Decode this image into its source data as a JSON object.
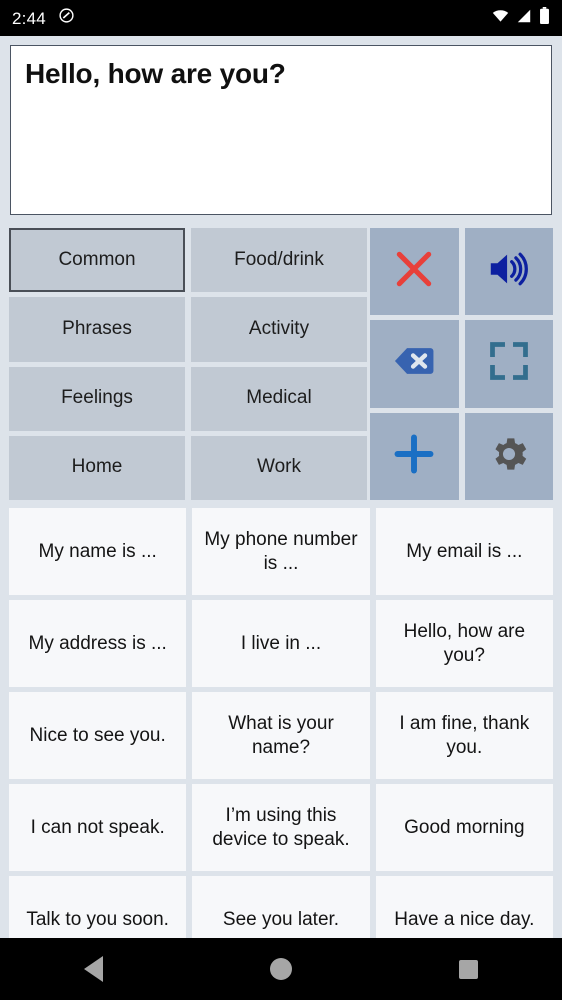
{
  "status_bar": {
    "time": "2:44",
    "left_icons": [
      "do-not-disturb-icon"
    ],
    "right_icons": [
      "wifi-icon",
      "cellular-signal-icon",
      "battery-icon"
    ]
  },
  "text_area": {
    "value": "Hello, how are you?",
    "placeholder": ""
  },
  "categories": {
    "selected": "Common",
    "items": [
      {
        "label": "Common"
      },
      {
        "label": "Food/drink"
      },
      {
        "label": "Phrases"
      },
      {
        "label": "Activity"
      },
      {
        "label": "Feelings"
      },
      {
        "label": "Medical"
      },
      {
        "label": "Home"
      },
      {
        "label": "Work"
      }
    ]
  },
  "actions": {
    "items": [
      {
        "name": "clear-button",
        "icon": "close-x-icon",
        "color": "#e8403a"
      },
      {
        "name": "speak-button",
        "icon": "speaker-volume-icon",
        "color": "#0d20a0"
      },
      {
        "name": "backspace-button",
        "icon": "backspace-icon",
        "color": "#3763b0"
      },
      {
        "name": "fullscreen-button",
        "icon": "fullscreen-icon",
        "color": "#336e8e"
      },
      {
        "name": "add-phrase-button",
        "icon": "plus-icon",
        "color": "#1a6fc4"
      },
      {
        "name": "settings-button",
        "icon": "gear-icon",
        "color": "#555555"
      }
    ]
  },
  "phrases": {
    "items": [
      "My name is ...",
      "My phone number is ...",
      "My email is ...",
      "My address is ...",
      "I live in ...",
      "Hello, how are you?",
      "Nice to see you.",
      "What is your name?",
      "I am fine, thank you.",
      "I can not speak.",
      "I’m using this device to speak.",
      "Good morning",
      "Talk to you soon.",
      "See you later.",
      "Have a nice day."
    ]
  },
  "nav_bar": {
    "back_label": "back-icon",
    "home_label": "home-icon",
    "recents_label": "recents-icon"
  },
  "colors": {
    "page_background": "#dde3ea",
    "category_button": "#c1c9d3",
    "action_button": "#9fafc4",
    "phrase_button": "#f7f8fa",
    "text_area_background": "#ffffff"
  }
}
